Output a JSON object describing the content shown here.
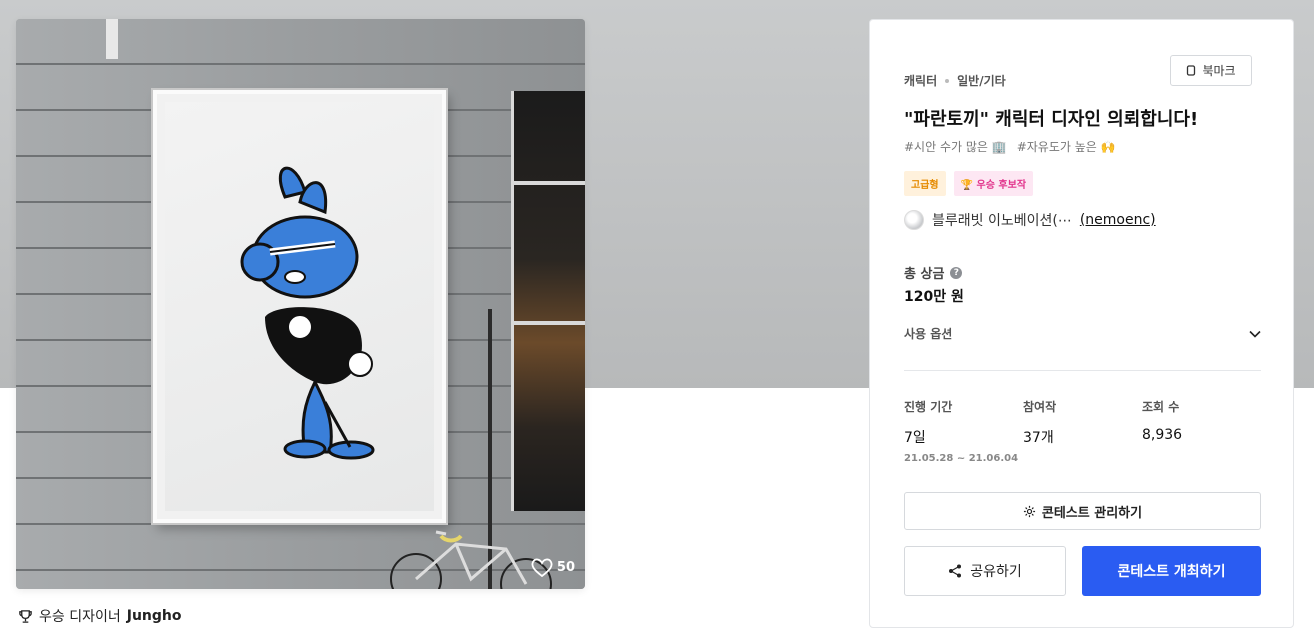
{
  "gallery": {
    "likes": "50",
    "winner_label": "우승 디자이너",
    "winner_name": "Jungho"
  },
  "contest": {
    "category": "캐릭터",
    "subcategory": "일반/기타",
    "bookmark_label": "북마크",
    "title": "\"파란토끼\" 캐릭터 디자인 의뢰합니다!",
    "tags": [
      "#시안 수가 많은 🏢",
      "#자유도가 높은 🙌"
    ],
    "badges": {
      "premium": "고급형",
      "candidate": "🏆 우승 후보작"
    },
    "host_name": "블루래빗 이노베이션(⋯",
    "host_handle": "(nemoenc)",
    "prize_label": "총 상금",
    "prize_value": "120만 원",
    "usage_label": "사용 옵션",
    "stats": {
      "period_label": "진행 기간",
      "period_value": "7일",
      "period_range": "21.05.28 ~ 21.06.04",
      "entries_label": "참여작",
      "entries_value": "37개",
      "views_label": "조회 수",
      "views_value": "8,936"
    },
    "manage_label": "콘테스트 관리하기",
    "share_label": "공유하기",
    "host_contest_label": "콘테스트 개최하기"
  },
  "colors": {
    "primary": "#2a5cf2",
    "bunny_blue": "#3a7fd9"
  }
}
